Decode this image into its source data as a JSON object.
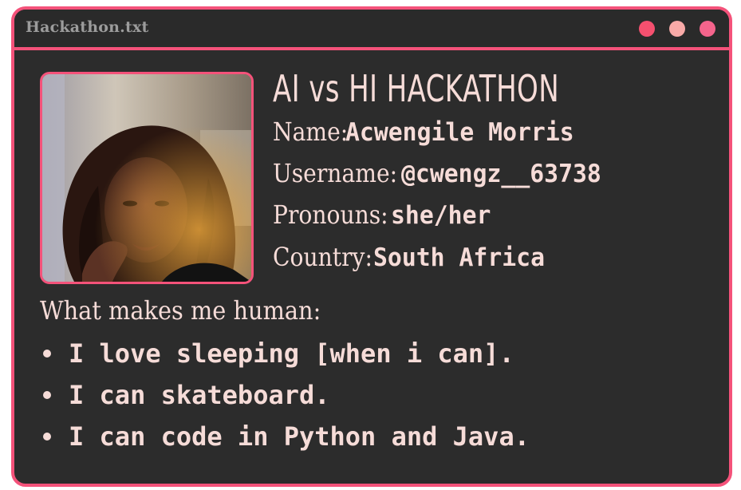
{
  "window": {
    "title": "Hackathon.txt",
    "controls": [
      {
        "name": "close",
        "color": "#f5506f"
      },
      {
        "name": "minimize",
        "color": "#f9aaa8"
      },
      {
        "name": "maximize",
        "color": "#f5648c"
      }
    ],
    "accent": "#f4527a"
  },
  "profile": {
    "heading": "AI vs HI HACKATHON",
    "photo_alt": "profile-photo",
    "fields": [
      {
        "label": "Name:",
        "value": "Acwengile Morris"
      },
      {
        "label": "Username:",
        "value": "@cwengz__63738"
      },
      {
        "label": "Pronouns:",
        "value": "she/her"
      },
      {
        "label": "Country:",
        "value": "South Africa"
      }
    ]
  },
  "human": {
    "heading": "What makes me human:",
    "traits": [
      "I love sleeping [when i can].",
      "I can skateboard.",
      "I can code in Python and Java."
    ]
  }
}
